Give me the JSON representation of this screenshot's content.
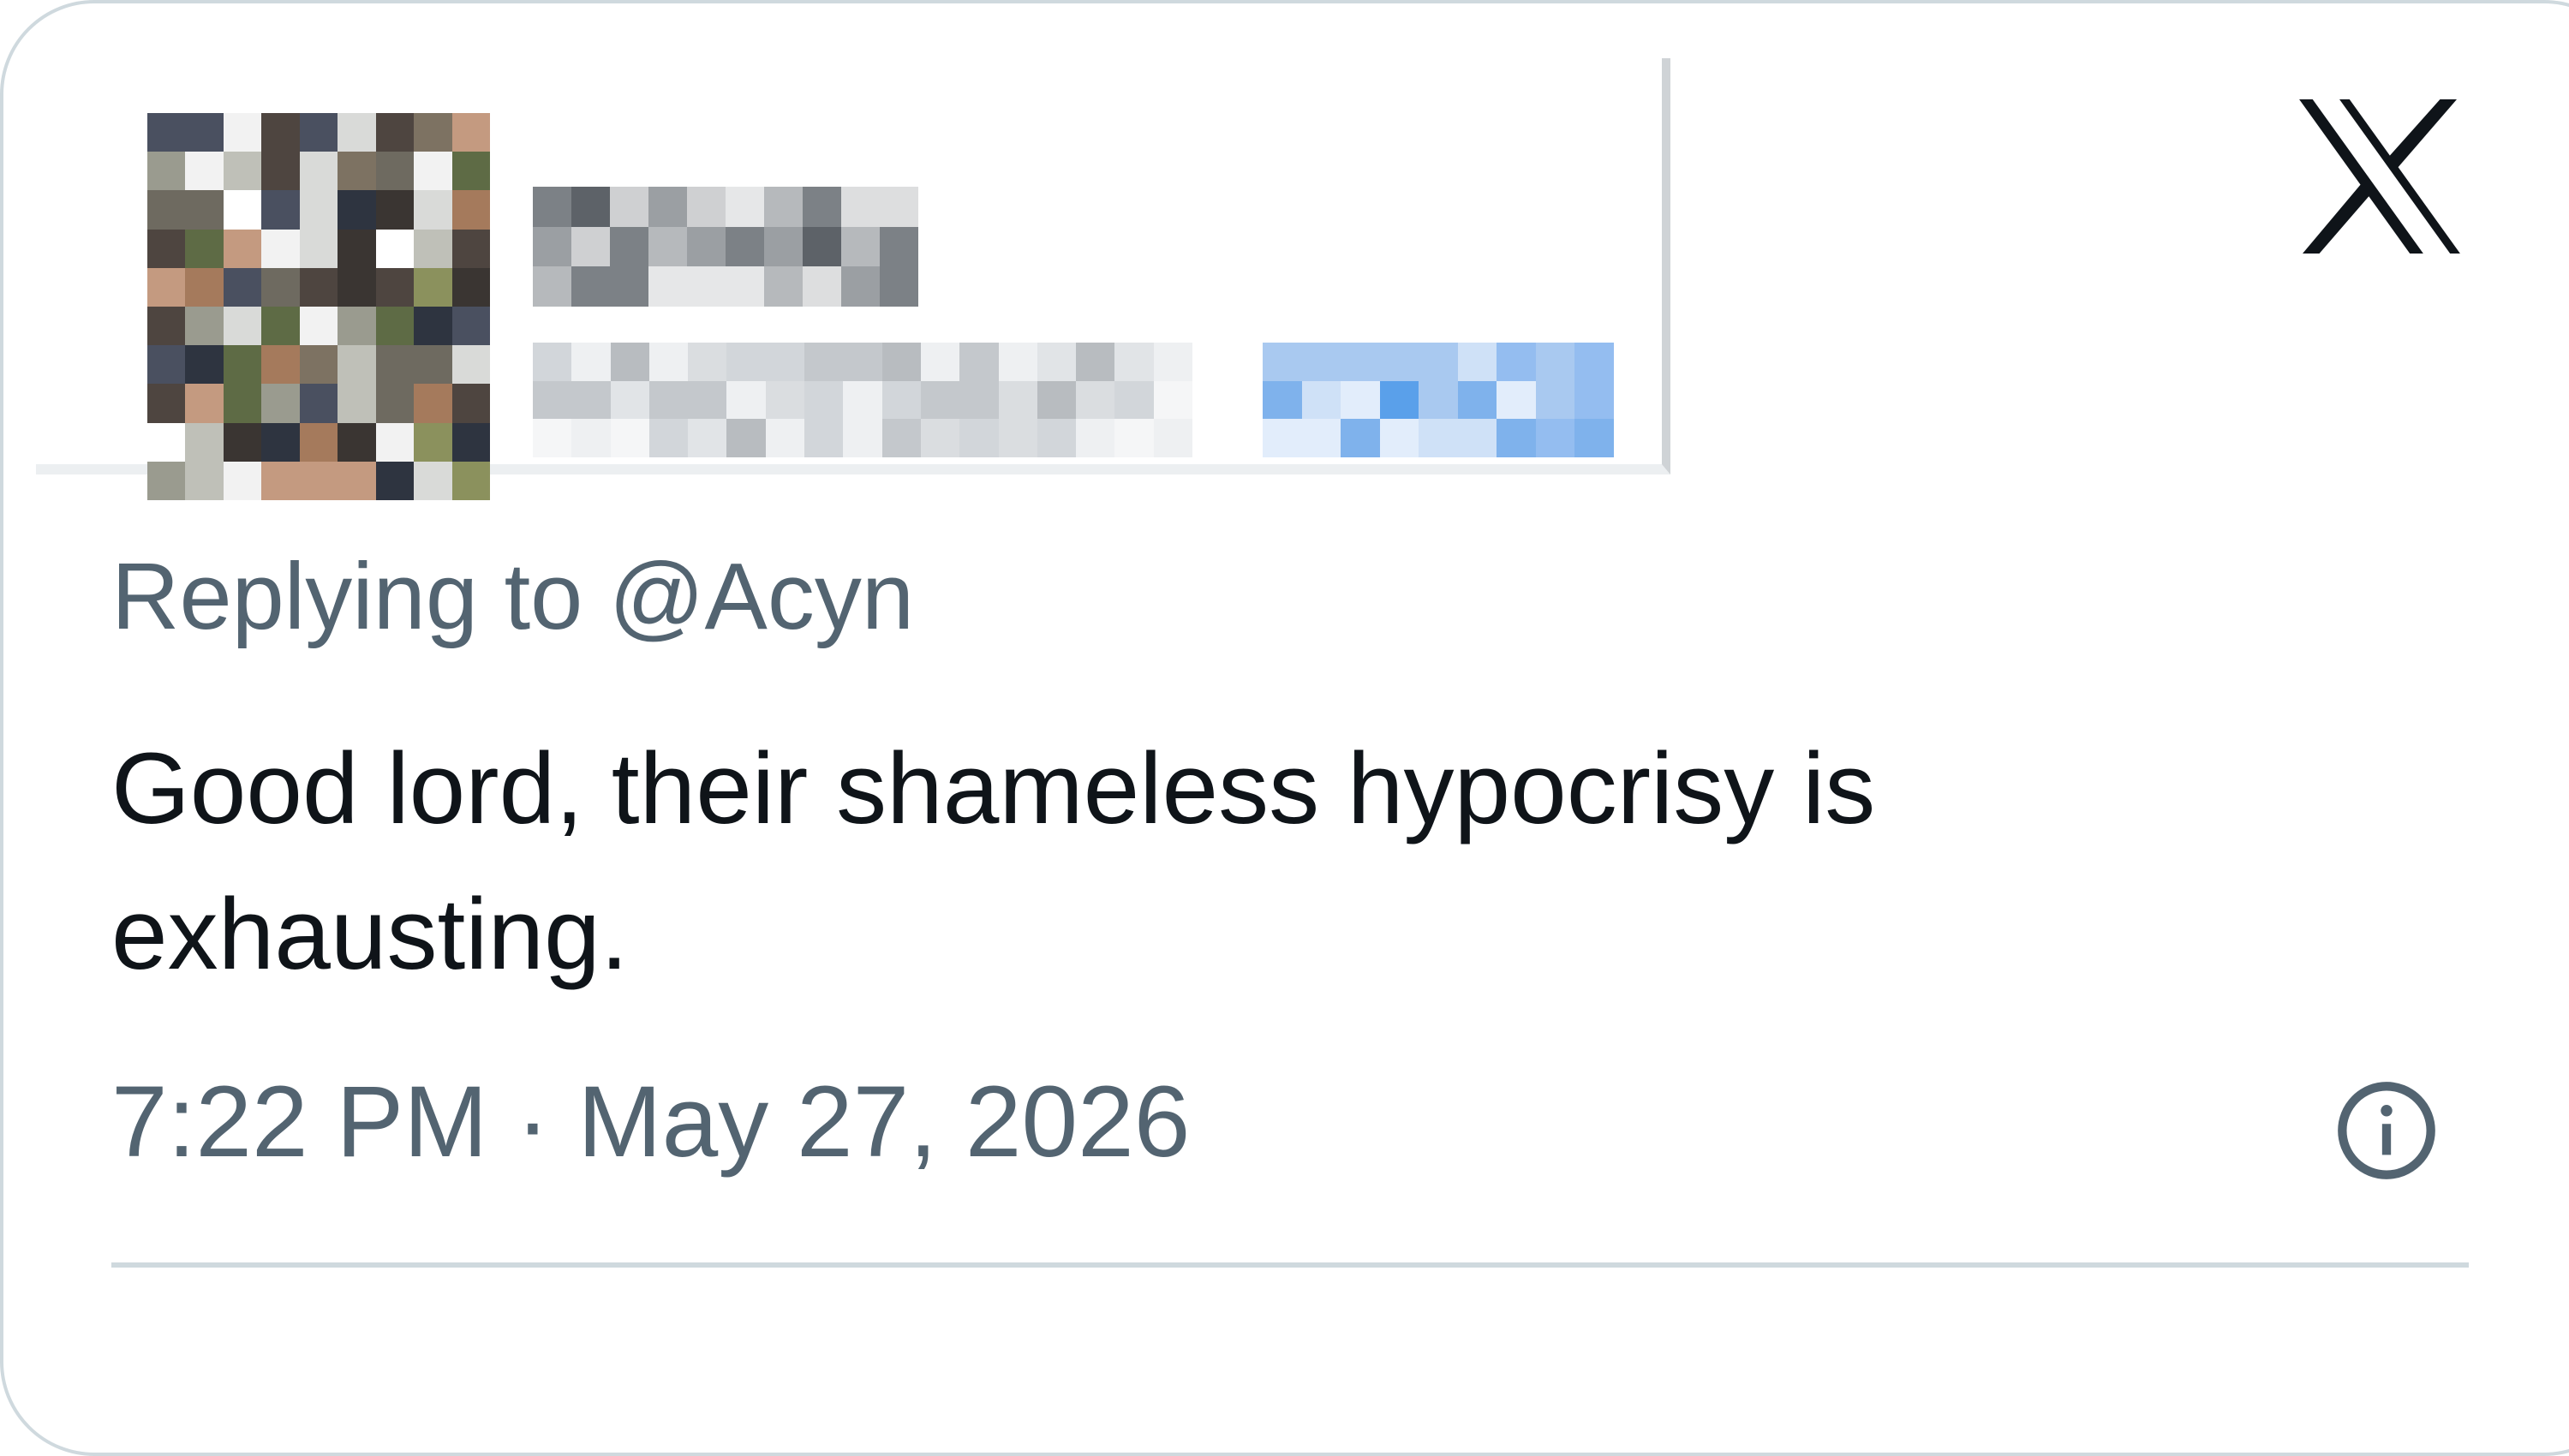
{
  "reply": {
    "prefix": "Replying to ",
    "handle": "@Acyn"
  },
  "tweet": {
    "line1": "Good lord, their shameless hypocrisy is",
    "line2": "exhausting."
  },
  "meta": {
    "timestamp": "7:22 PM · May 27, 2026"
  },
  "icons": {
    "brand": "x-logo-icon",
    "info": "info-icon"
  },
  "colors": {
    "text_primary": "#0f1419",
    "text_secondary": "#536471",
    "follow_link": "#1d9bf0",
    "border": "#cfd9de"
  }
}
